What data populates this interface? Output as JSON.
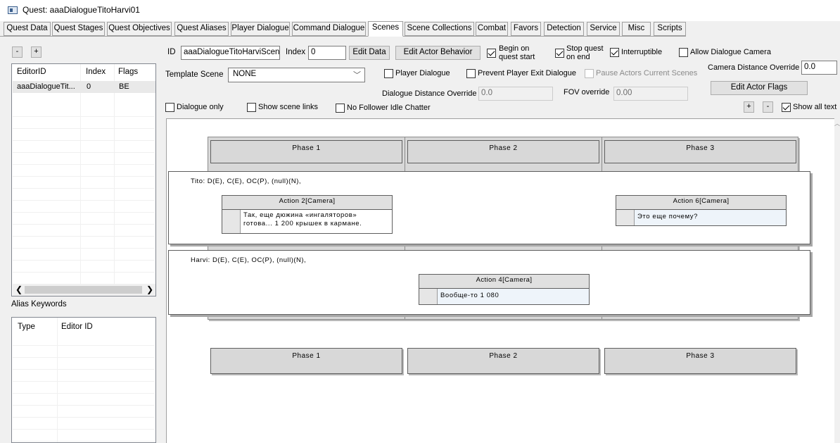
{
  "window": {
    "title": "Quest: aaaDialogueTitoHarvi01"
  },
  "tabs": [
    "Quest Data",
    "Quest Stages",
    "Quest Objectives",
    "Quest Aliases",
    "Player Dialogue",
    "Command Dialogue",
    "Scenes",
    "Scene Collections",
    "Combat",
    "Favors",
    "Detection",
    "Service",
    "Misc",
    "Scripts"
  ],
  "active_tab": "Scenes",
  "scene_list": {
    "minus_label": "-",
    "plus_label": "+",
    "headers": {
      "editor_id": "EditorID",
      "index": "Index",
      "flags": "Flags"
    },
    "rows": [
      {
        "editor_id": "aaaDialogueTit...",
        "index": "0",
        "flags": "BE"
      }
    ]
  },
  "alias_keywords": {
    "label": "Alias Keywords",
    "headers": {
      "type": "Type",
      "editor_id": "Editor ID"
    }
  },
  "form": {
    "id_label": "ID",
    "id_value": "aaaDialogueTitoHarviScene",
    "index_label": "Index",
    "index_value": "0",
    "edit_data": "Edit Data",
    "edit_actor_behavior": "Edit Actor Behavior",
    "begin_on_quest_start": "Begin on\nquest start",
    "stop_quest_on_end": "Stop quest\non end",
    "interruptible": "Interruptible",
    "allow_dialogue_camera": "Allow Dialogue Camera",
    "camera_distance_override_label": "Camera Distance Override",
    "camera_distance_override_value": "0.0",
    "template_scene_label": "Template Scene",
    "template_scene_value": "NONE",
    "player_dialogue": "Player Dialogue",
    "prevent_player_exit": "Prevent Player Exit Dialogue",
    "pause_actors": "Pause Actors Current Scenes",
    "edit_actor_flags": "Edit Actor Flags",
    "dialogue_distance_label": "Dialogue Distance Override",
    "dialogue_distance_value": "0.0",
    "fov_label": "FOV override",
    "fov_value": "0.00",
    "dialogue_only": "Dialogue only",
    "show_scene_links": "Show scene links",
    "no_follower_idle": "No Follower Idle Chatter",
    "zoom_plus": "+",
    "zoom_minus": "-",
    "show_all_text": "Show all text"
  },
  "scene": {
    "phases": [
      "Phase 1",
      "Phase 2",
      "Phase 3"
    ],
    "actors": [
      {
        "label": "Tito: D(E), C(E), OC(P), (null)(N),",
        "actions": [
          {
            "title": "Action 2[Camera]",
            "text": "Так, еще дюжина «ингаляторов»\nготова... 1 200 крышек в кармане."
          },
          {
            "title": "Action 6[Camera]",
            "text": "Это еще почему?"
          }
        ]
      },
      {
        "label": "Harvi: D(E), C(E), OC(P), (null)(N),",
        "actions": [
          {
            "title": "Action 4[Camera]",
            "text": "Вообще-то 1 080"
          }
        ]
      }
    ]
  }
}
